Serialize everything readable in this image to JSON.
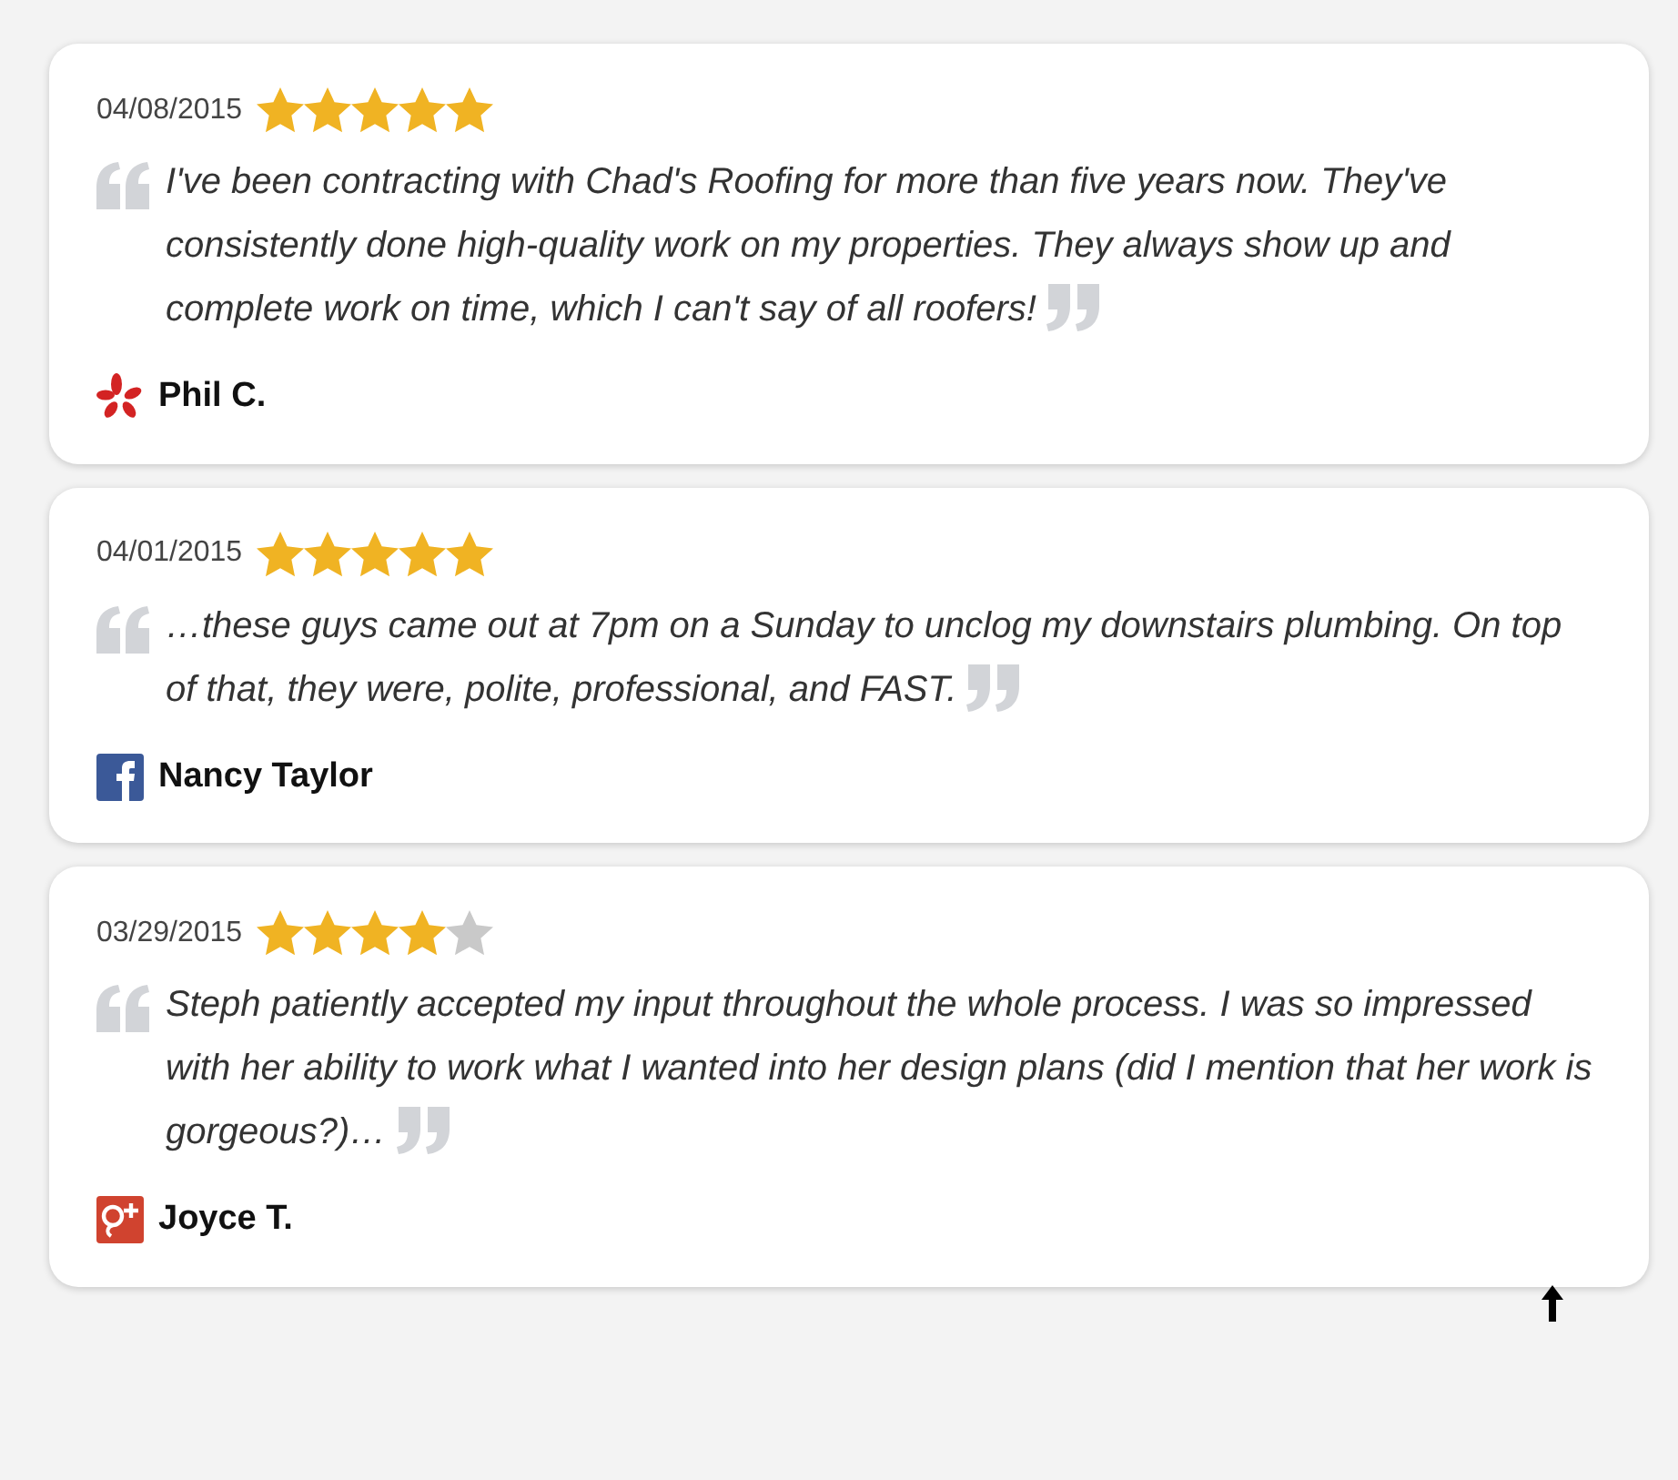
{
  "reviews": [
    {
      "date": "04/08/2015",
      "stars": 5,
      "text": "I've been contracting with Chad's Roofing for more than five years now. They've consistently done high-quality work on my properties. They always show up and complete work on time, which I can't say of all roofers!",
      "source": {
        "kind": "yelp"
      },
      "author": "Phil C."
    },
    {
      "date": "04/01/2015",
      "stars": 5,
      "text": "…these guys came out at 7pm on a Sunday to unclog my downstairs plumbing. On top of that, they were, polite, professional, and FAST.",
      "source": {
        "kind": "facebook"
      },
      "author": "Nancy Taylor"
    },
    {
      "date": "03/29/2015",
      "stars": 4,
      "text": "Steph patiently accepted my input throughout the whole process. I was so impressed with her ability to work what I wanted into her design plans (did I mention that her work is gorgeous?)…",
      "source": {
        "kind": "google-plus"
      },
      "author": "Joyce T."
    }
  ]
}
